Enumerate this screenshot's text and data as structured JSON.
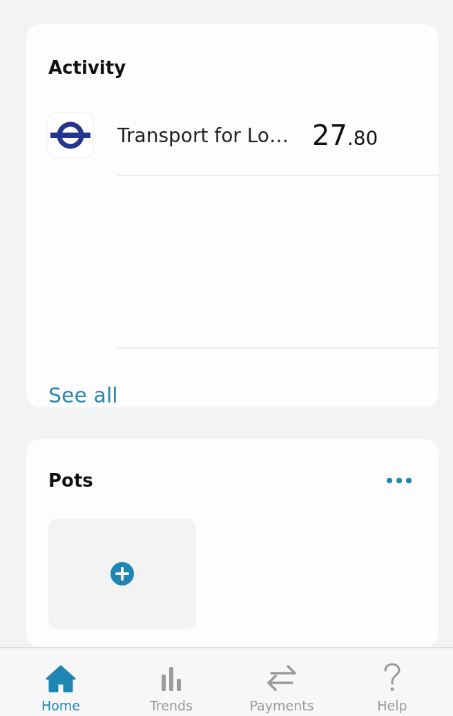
{
  "activity": {
    "title": "Activity",
    "transactions": [
      {
        "merchant": "Transport for Lo…",
        "amount_major": "27",
        "amount_minor": ".80"
      }
    ],
    "see_all": "See all"
  },
  "pots": {
    "title": "Pots"
  },
  "tabs": [
    {
      "label": "Home",
      "kind": "home",
      "selected": true
    },
    {
      "label": "Trends",
      "kind": "trends",
      "selected": false
    },
    {
      "label": "Payments",
      "kind": "payments",
      "selected": false
    },
    {
      "label": "Help",
      "kind": "help",
      "selected": false
    }
  ]
}
